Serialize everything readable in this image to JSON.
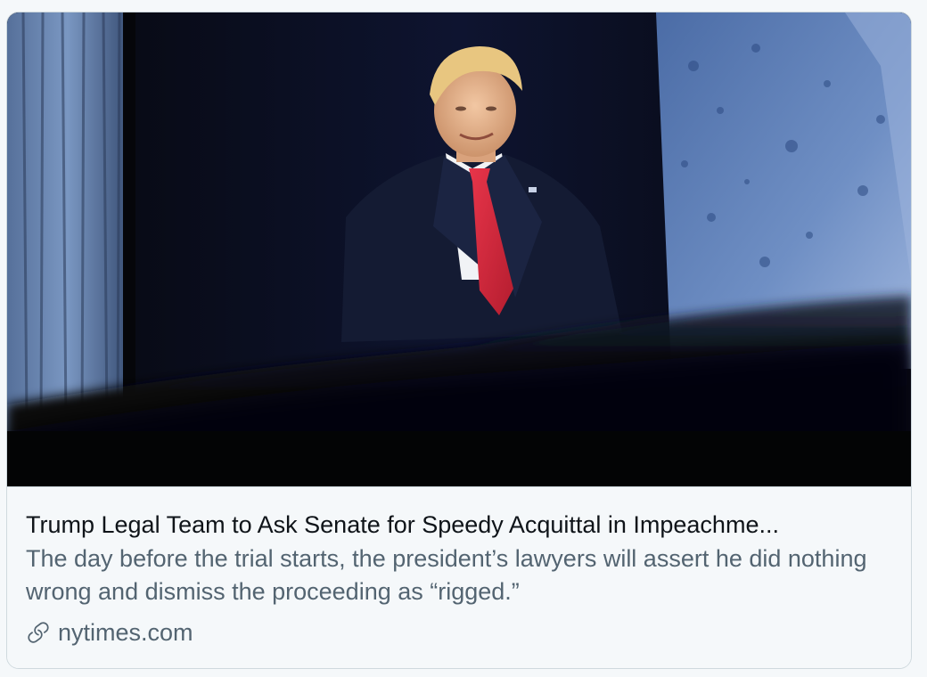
{
  "card": {
    "image_alt": "Donald Trump in a dark suit and red tie standing in front of a dark curtain, partially obscured by a blurred foreground",
    "title": "Trump Legal Team to Ask Senate for Speedy Acquittal in Impeachme...",
    "description": "The day before the trial starts, the president’s lawyers will assert he did nothing wrong and dismiss the proceeding as “rigged.”",
    "domain": "nytimes.com",
    "domain_icon": "link-icon"
  },
  "colors": {
    "title_text": "#0f1419",
    "secondary_text": "#536471",
    "card_background": "#f5f8fa",
    "card_border": "#cfd9de"
  }
}
